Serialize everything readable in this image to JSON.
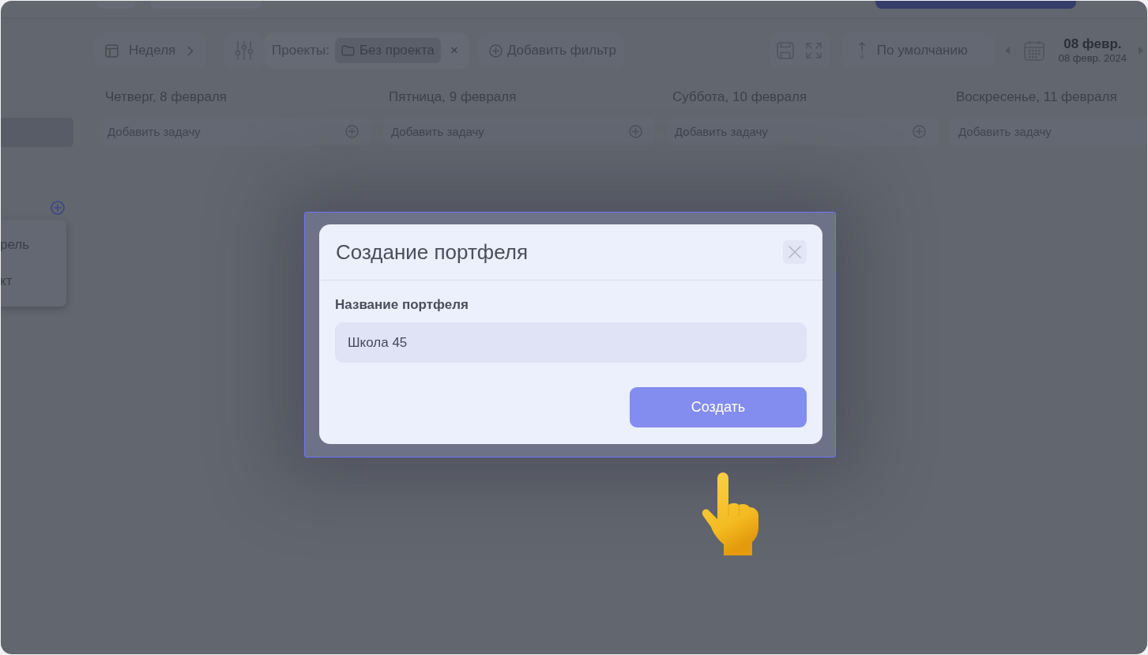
{
  "sidebar": {
    "menu": {
      "items": [
        {
          "label": "рель"
        },
        {
          "label": "кт"
        }
      ]
    }
  },
  "toolbar": {
    "view": {
      "label": "Неделя"
    },
    "filter": {
      "label": "Проекты:",
      "chip": {
        "label": "Без проекта",
        "remove": "×"
      }
    },
    "add_filter": {
      "label": "Добавить фильтр"
    },
    "sort": {
      "label": "По умолчанию"
    },
    "date": {
      "short": "08 февр.",
      "full": "08 февр. 2024"
    }
  },
  "days": [
    {
      "title": "Четверг, 8 февраля",
      "placeholder": "Добавить задачу"
    },
    {
      "title": "Пятница, 9 февраля",
      "placeholder": "Добавить задачу"
    },
    {
      "title": "Суббота, 10 февраля",
      "placeholder": "Добавить задачу"
    },
    {
      "title": "Воскресенье, 11 февраля",
      "placeholder": "Добавить задачу"
    }
  ],
  "dialog": {
    "title": "Создание портфеля",
    "field": {
      "label": "Название портфеля",
      "value": "Школа 45"
    },
    "submit": "Создать"
  }
}
